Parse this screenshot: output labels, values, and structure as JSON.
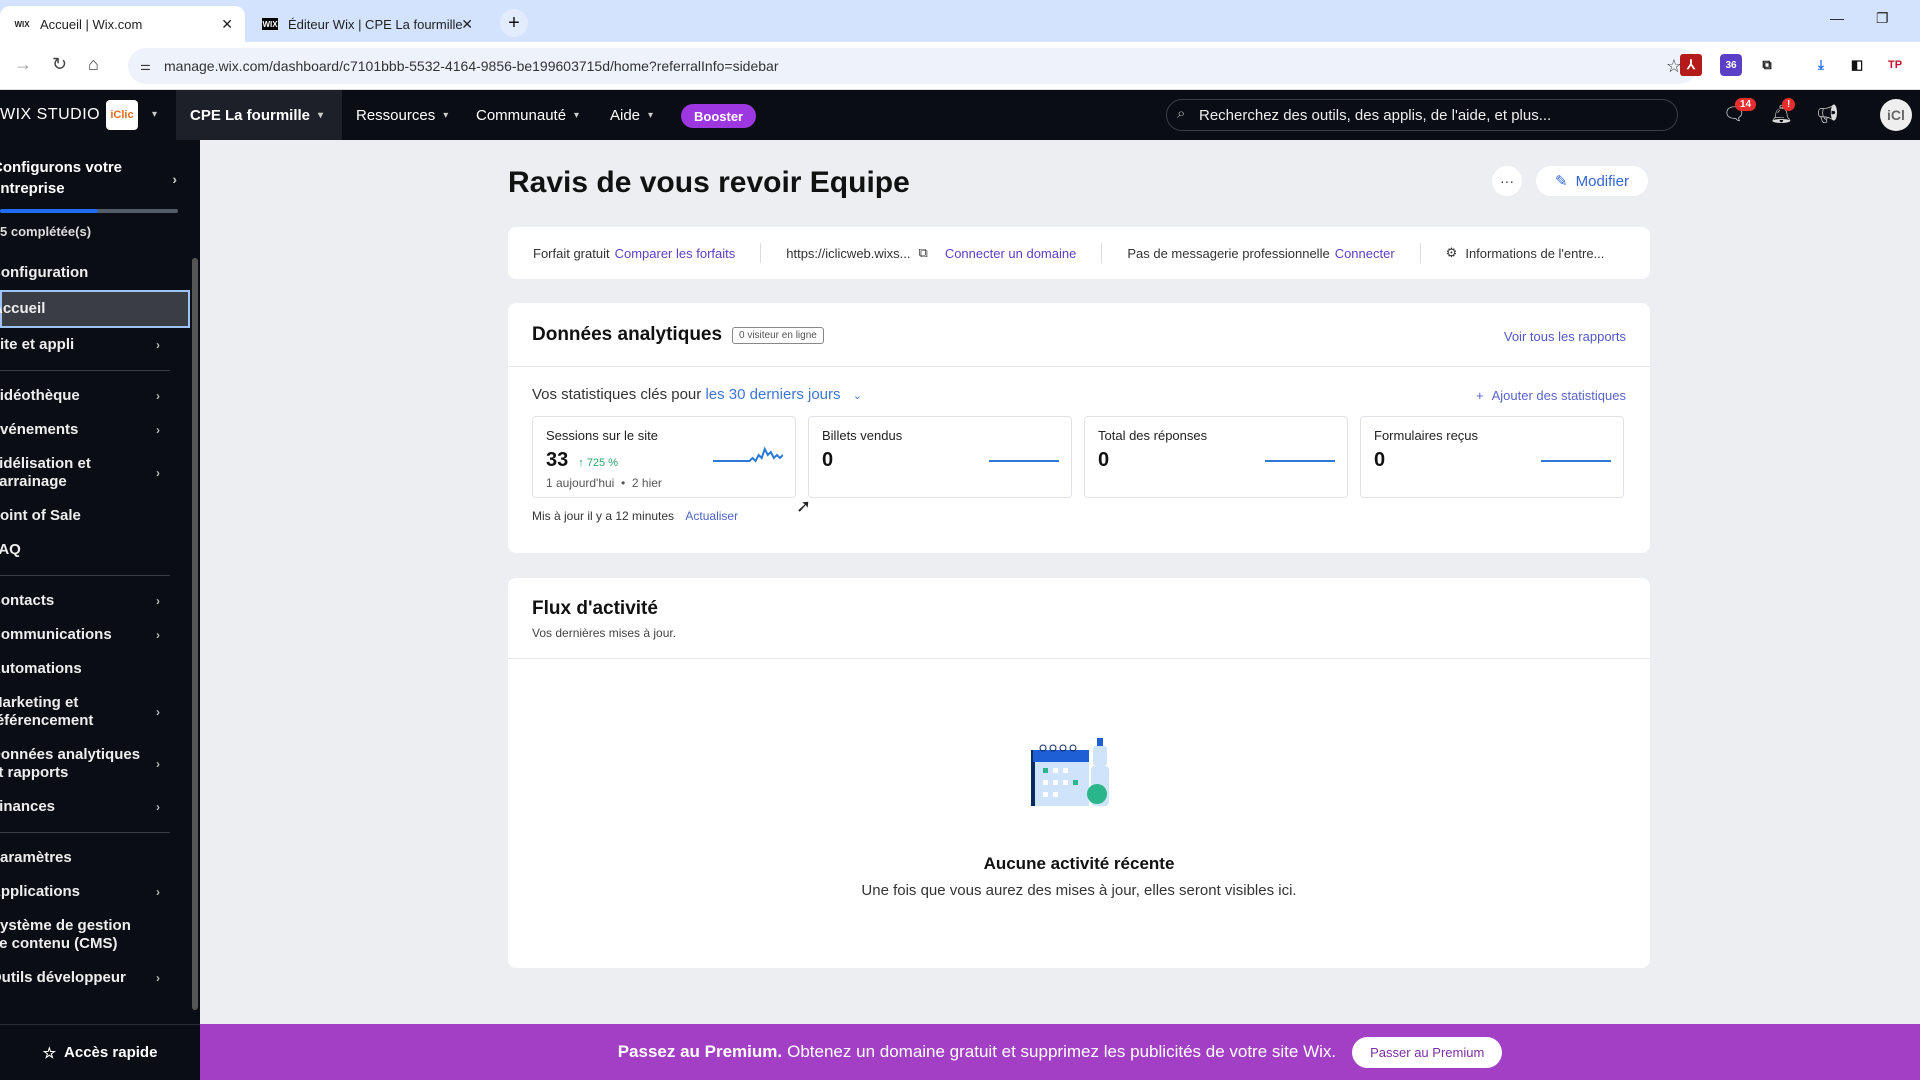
{
  "browser": {
    "tabs": [
      {
        "title": "Accueil | Wix.com",
        "favicon": "WIX",
        "active": true
      },
      {
        "title": "Éditeur Wix | CPE La fourmille",
        "favicon": "WIX",
        "active": false
      }
    ],
    "new_tab": "+",
    "close": "✕",
    "url": "manage.wix.com/dashboard/c7101bbb-5532-4164-9856-be199603715d/home?referralInfo=sidebar",
    "extensions": {
      "badge_count": "36"
    }
  },
  "topbar": {
    "logo": "WIX STUDIO",
    "site_logo": "iClic",
    "site_name": "CPE La fourmille",
    "nav": [
      "Ressources",
      "Communauté",
      "Aide"
    ],
    "booster": "Booster",
    "search_placeholder": "Recherchez des outils, des applis, de l'aide, et plus...",
    "messages_badge": "14",
    "notifications_badge": "!",
    "avatar": "iCl"
  },
  "sidebar": {
    "setup_title": "Configurons votre entreprise",
    "setup_progress": 0.55,
    "completed": "5 complétée(s)",
    "groups": [
      [
        {
          "label": "Configuration",
          "chevron": false
        },
        {
          "label": "Accueil",
          "chevron": false,
          "active": true
        },
        {
          "label": "Site et appli",
          "chevron": true
        }
      ],
      [
        {
          "label": "Vidéothèque",
          "chevron": true
        },
        {
          "label": "Événements",
          "chevron": true
        },
        {
          "label": "Fidélisation et parrainage",
          "chevron": true
        },
        {
          "label": "Point of Sale",
          "chevron": false
        },
        {
          "label": "FAQ",
          "chevron": false
        }
      ],
      [
        {
          "label": "Contacts",
          "chevron": true
        },
        {
          "label": "Communications",
          "chevron": true
        },
        {
          "label": "Automations",
          "chevron": false
        },
        {
          "label": "Marketing et référencement",
          "chevron": true
        },
        {
          "label": "Données analytiques et rapports",
          "chevron": true
        },
        {
          "label": "Finances",
          "chevron": true
        }
      ],
      [
        {
          "label": "Paramètres",
          "chevron": false
        },
        {
          "label": "Applications",
          "chevron": true
        },
        {
          "label": "Système de gestion de contenu (CMS)",
          "chevron": false
        },
        {
          "label": "Outils développeur",
          "chevron": true
        }
      ]
    ],
    "quick_access": "Accès rapide"
  },
  "main": {
    "title": "Ravis de vous revoir Equipe",
    "more_label": "···",
    "edit_label": "Modifier",
    "infobar": {
      "plan": "Forfait gratuit",
      "compare_plans": "Comparer les forfaits",
      "site_url": "https://iclicweb.wixs...",
      "connect_domain": "Connecter un domaine",
      "no_mail": "Pas de messagerie professionnelle",
      "connect": "Connecter",
      "business_info": "Informations de l'entre..."
    },
    "analytics": {
      "title": "Données analytiques",
      "online_badge": "0 visiteur en ligne",
      "see_all": "Voir tous les rapports",
      "stats_prefix": "Vos statistiques clés pour",
      "period": "les 30 derniers jours",
      "add_stats": "Ajouter des statistiques",
      "kpis": [
        {
          "label": "Sessions sur le site",
          "value": "33",
          "delta": "725 %",
          "sub_today": "1 aujourd'hui",
          "sub_yesterday": "2 hier",
          "trend": [
            0,
            0,
            0,
            0,
            0,
            0,
            0,
            0,
            0,
            0,
            0,
            0,
            0,
            1,
            0,
            2,
            1,
            4,
            2,
            3,
            1,
            2,
            1,
            2
          ]
        },
        {
          "label": "Billets vendus",
          "value": "0",
          "trend": [
            0,
            0
          ]
        },
        {
          "label": "Total des réponses",
          "value": "0",
          "trend": [
            0,
            0
          ]
        },
        {
          "label": "Formulaires reçus",
          "value": "0",
          "trend": [
            0,
            0
          ]
        }
      ],
      "updated": "Mis à jour il y a 12 minutes",
      "refresh": "Actualiser"
    },
    "activity": {
      "title": "Flux d'activité",
      "subtitle": "Vos dernières mises à jour.",
      "empty_title": "Aucune activité récente",
      "empty_text": "Une fois que vous aurez des mises à jour, elles seront visibles ici."
    }
  },
  "premium_banner": {
    "bold": "Passez au Premium.",
    "text": "Obtenez un domaine gratuit et supprimez les publicités de votre site Wix.",
    "button": "Passer au Premium"
  }
}
